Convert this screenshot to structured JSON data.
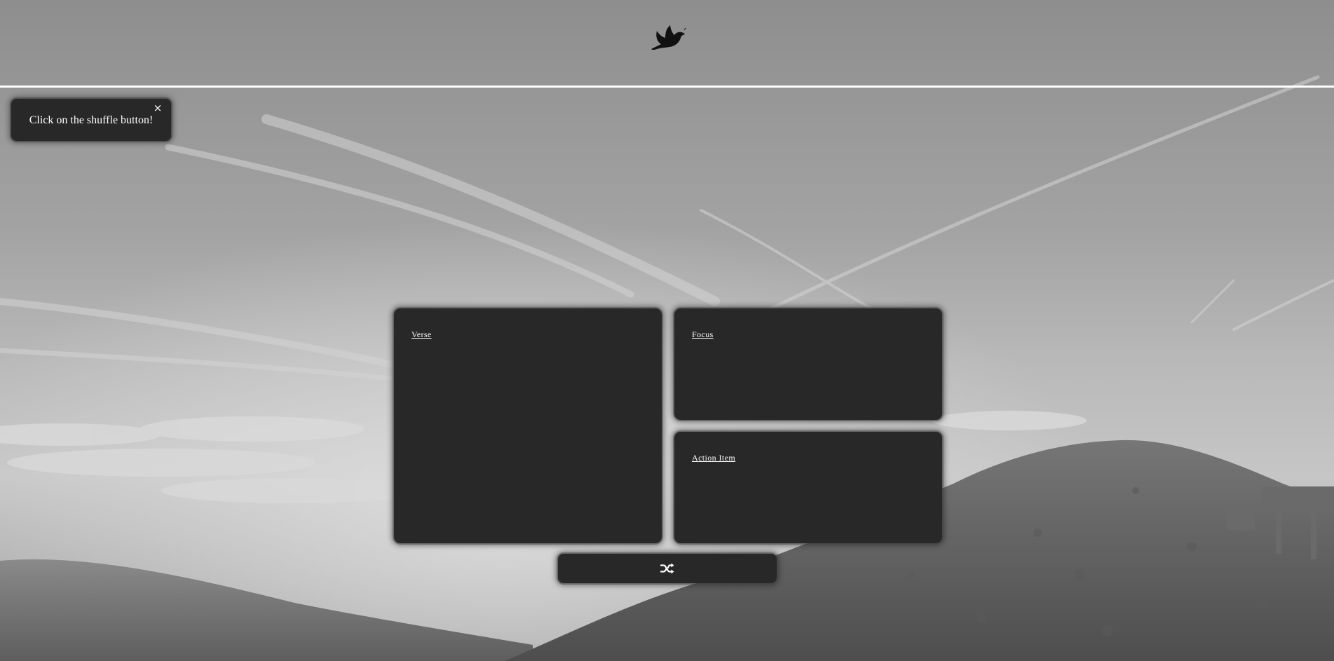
{
  "header": {
    "logo_icon": "dove-icon",
    "rule_color": "#ffffff"
  },
  "toast": {
    "message": "Click on the shuffle button!",
    "close_label": "×",
    "close_icon": "close-icon"
  },
  "cards": {
    "verse": {
      "title": "Verse"
    },
    "focus": {
      "title": "Focus"
    },
    "action": {
      "title": "Action Item"
    }
  },
  "shuffle": {
    "icon": "shuffle-icon"
  },
  "colors": {
    "card_background": "#282828",
    "text": "#ffffff",
    "page_background": "#8f8f8f"
  }
}
